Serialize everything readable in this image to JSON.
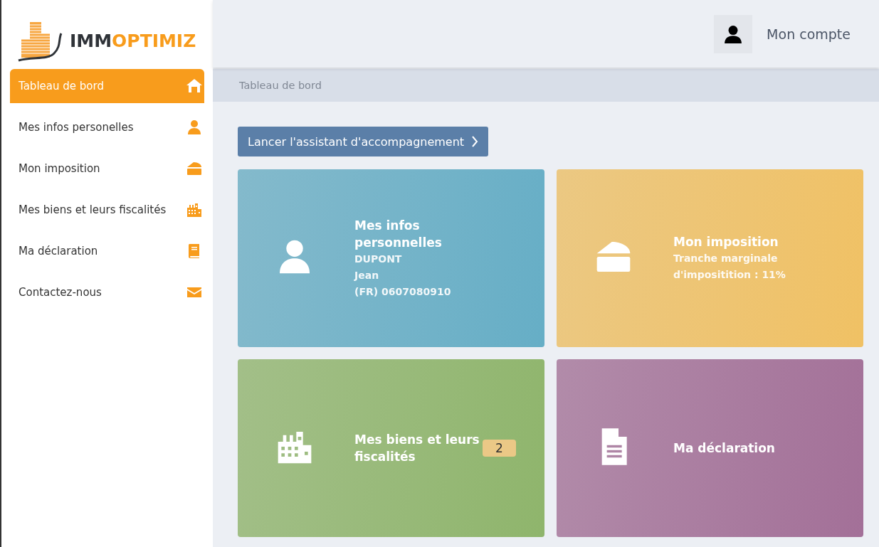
{
  "logo": {
    "text_dark": "IMM",
    "text_accent": "OPTIMIZ"
  },
  "sidebar": {
    "items": [
      {
        "label": "Tableau de bord",
        "kind": "home",
        "selected": true
      },
      {
        "label": "Mes infos personelles",
        "kind": "person",
        "selected": false
      },
      {
        "label": "Mon imposition",
        "kind": "cake",
        "selected": false
      },
      {
        "label": "Mes biens et leurs fiscalités",
        "kind": "buildings",
        "selected": false
      },
      {
        "label": "Ma déclaration",
        "kind": "book",
        "selected": false
      },
      {
        "label": "Contactez-nous",
        "kind": "envelope",
        "selected": false
      }
    ]
  },
  "header": {
    "account": "Mon compte"
  },
  "breadcrumb": "Tableau de bord",
  "assistant_button": "Lancer l'assistant d'accompagnement",
  "cards": [
    {
      "kind": "person",
      "title": "Mes infos personnelles",
      "lines": [
        "DUPONT",
        "Jean",
        "(FR) 0607080910"
      ],
      "color": "#66aec6"
    },
    {
      "kind": "cake",
      "title": "Mon imposition",
      "lines": [
        "Tranche marginale d'impositition : 11%"
      ],
      "color": "#f0c164"
    },
    {
      "kind": "buildings",
      "title": "Mes biens et leurs fiscalités",
      "badge": "2",
      "color": "#8fb56c"
    },
    {
      "kind": "document",
      "title": "Ma déclaration",
      "color": "#a37098"
    }
  ]
}
